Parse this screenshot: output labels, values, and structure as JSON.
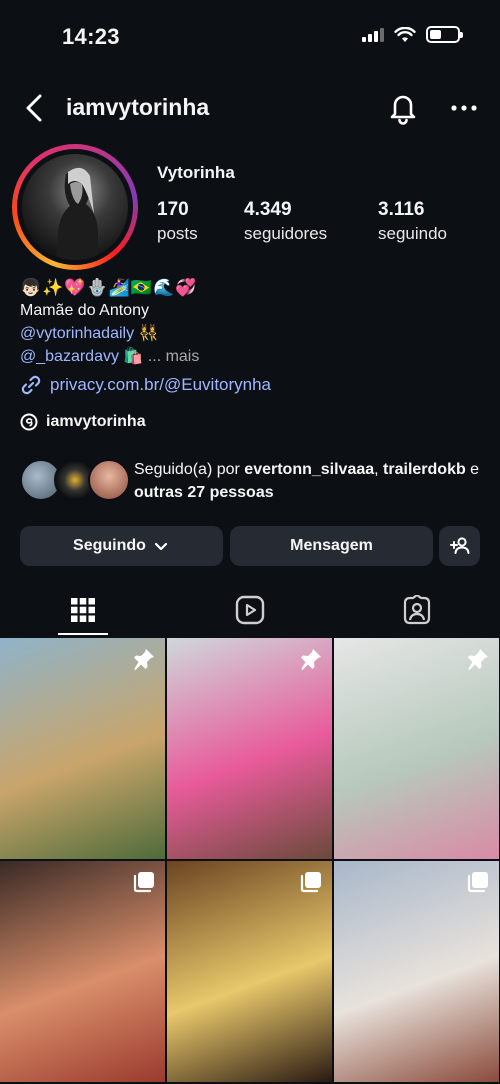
{
  "status_bar": {
    "time": "14:23"
  },
  "header": {
    "username": "iamvytorinha"
  },
  "profile": {
    "display_name": "Vytorinha",
    "stats": [
      {
        "value": "170",
        "label": "posts"
      },
      {
        "value": "4.349",
        "label": "seguidores"
      },
      {
        "value": "3.116",
        "label": "seguindo"
      }
    ],
    "bio": {
      "emoji_line": "👦🏻✨💖🪬🏄‍♀️🇧🇷🌊💞",
      "line1": "Mamãe do Antony",
      "handle1": "@vytorinhadaily",
      "handle1_emoji": "👯‍♀️",
      "handle2": "@_bazardavy",
      "handle2_emoji": "🛍️",
      "more": "... mais"
    },
    "link": "privacy.com.br/@Euvitorynha",
    "threads_handle": "iamvytorinha"
  },
  "followed_by": {
    "prefix": "Seguido(a) por ",
    "user1": "evertonn_silvaaa",
    "sep": ", ",
    "user2": "trailerdokb",
    "mid": " e ",
    "others": "outras 27 pessoas"
  },
  "actions": {
    "following_label": "Seguindo",
    "message_label": "Mensagem"
  },
  "tabs": [
    "grid-icon",
    "reels-icon",
    "tagged-icon"
  ],
  "posts": [
    {
      "kind": "pinned",
      "icon": "pin-icon",
      "colors": [
        "#8fb3c9",
        "#c9a56b",
        "#4e6b3a"
      ]
    },
    {
      "kind": "pinned",
      "icon": "pin-icon",
      "colors": [
        "#cfd8dc",
        "#e85b9a",
        "#6b4a3a"
      ]
    },
    {
      "kind": "pinned",
      "icon": "pin-icon",
      "colors": [
        "#e6e6e6",
        "#b7c9bc",
        "#d98aa5"
      ]
    },
    {
      "kind": "carousel",
      "icon": "carousel-icon",
      "colors": [
        "#3a2a26",
        "#d98f6b",
        "#9a3a2e"
      ]
    },
    {
      "kind": "carousel",
      "icon": "carousel-icon",
      "colors": [
        "#6b4422",
        "#e8c86b",
        "#2a1a12"
      ]
    },
    {
      "kind": "carousel",
      "icon": "carousel-icon",
      "colors": [
        "#a9b7c9",
        "#e8e2dc",
        "#8a4a3a"
      ]
    }
  ]
}
